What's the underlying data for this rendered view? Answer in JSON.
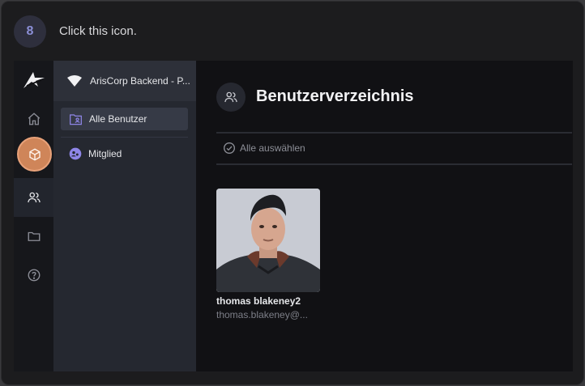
{
  "tutorial": {
    "step_number": "8",
    "instruction": "Click this icon."
  },
  "sidebar_rail": {
    "items": [
      {
        "icon": "home-icon"
      },
      {
        "icon": "box-icon",
        "highlighted": true
      },
      {
        "icon": "users-icon",
        "active": true
      },
      {
        "icon": "folder-icon"
      },
      {
        "icon": "help-icon"
      }
    ]
  },
  "panel": {
    "header_label": "ArisCorp Backend - P...",
    "items": [
      {
        "label": "Alle Benutzer",
        "icon": "folder-user-icon",
        "selected": true
      },
      {
        "label": "Mitglied",
        "icon": "group-icon"
      }
    ]
  },
  "main": {
    "title": "Benutzerverzeichnis",
    "select_all_label": "Alle auswählen",
    "users": [
      {
        "name": "thomas blakeney2",
        "email": "thomas.blakeney@..."
      }
    ]
  },
  "colors": {
    "highlight": "#cf8559",
    "accent": "#8b8fd6",
    "background": "#111114"
  }
}
